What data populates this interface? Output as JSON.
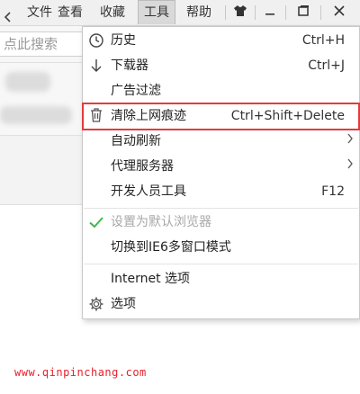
{
  "menubar": {
    "collapse_icon": "chevron-left-icon",
    "items": [
      {
        "label": "文件"
      },
      {
        "label": "查看"
      },
      {
        "label": "收藏"
      },
      {
        "label": "工具"
      },
      {
        "label": "帮助"
      }
    ],
    "active_item": "工具",
    "window_controls": [
      "skin-icon",
      "minimize-icon",
      "restore-icon",
      "close-icon"
    ]
  },
  "addressbar": {
    "search_placeholder": "点此搜索"
  },
  "tools_menu": {
    "items": [
      {
        "label": "历史",
        "shortcut": "Ctrl+H",
        "icon": "clock-icon"
      },
      {
        "label": "下载器",
        "shortcut": "Ctrl+J",
        "icon": "download-arrow-icon"
      },
      {
        "label": "广告过滤",
        "shortcut": "",
        "icon": ""
      },
      {
        "label": "清除上网痕迹",
        "shortcut": "Ctrl+Shift+Delete",
        "icon": "trash-icon",
        "highlighted": true
      },
      {
        "label": "自动刷新",
        "shortcut": "",
        "icon": "",
        "submenu": true
      },
      {
        "label": "代理服务器",
        "shortcut": "",
        "icon": "",
        "submenu": true
      },
      {
        "label": "开发人员工具",
        "shortcut": "F12",
        "icon": ""
      },
      {
        "label": "设置为默认浏览器",
        "shortcut": "",
        "icon": "checkmark-icon",
        "disabled": true
      },
      {
        "label": "切换到IE6多窗口模式",
        "shortcut": "",
        "icon": ""
      },
      {
        "label": "Internet 选项",
        "shortcut": "",
        "icon": ""
      },
      {
        "label": "选项",
        "shortcut": "",
        "icon": "gear-icon"
      }
    ],
    "submenu_glyph": "›",
    "highlight_color": "#e23b3b",
    "check_color": "#3cb84a"
  },
  "watermark": {
    "text": "www.qinpinchang.com",
    "color": "#e8202a"
  }
}
